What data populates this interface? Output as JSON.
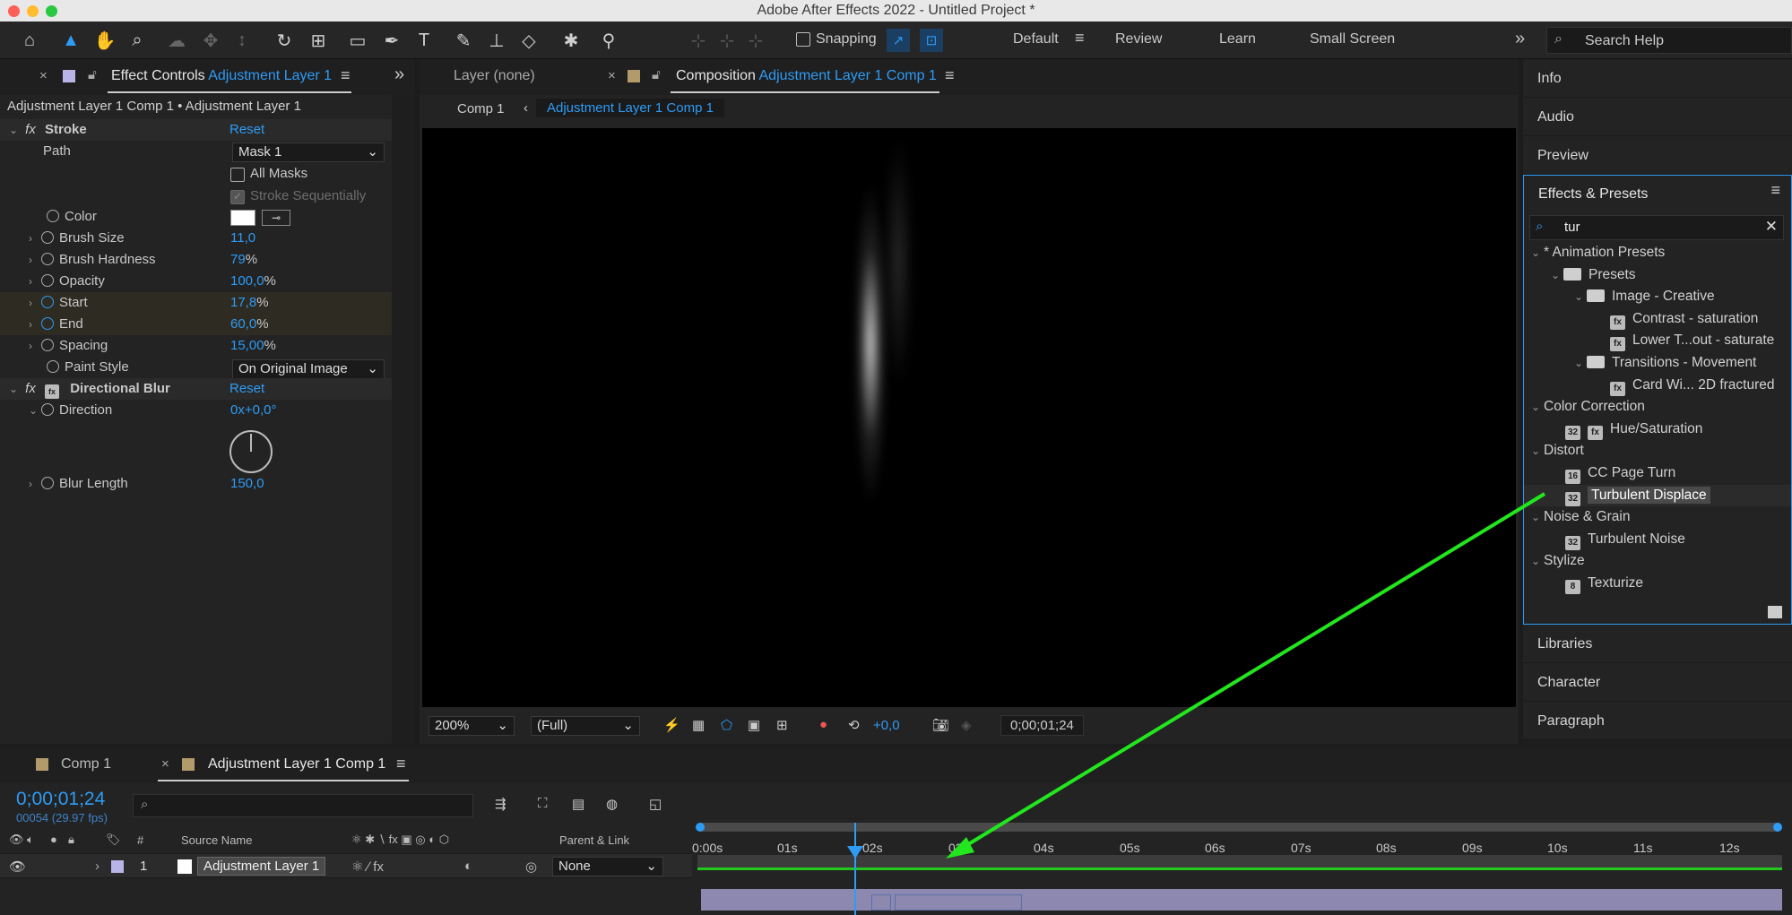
{
  "window": {
    "title": "Adobe After Effects 2022 - Untitled Project *"
  },
  "toolbar": {
    "snapping_label": "Snapping",
    "workspaces": [
      "Default",
      "Review",
      "Learn",
      "Small Screen"
    ],
    "search_help_placeholder": "Search Help",
    "more": "»"
  },
  "effect_controls": {
    "tab_label": "Effect Controls",
    "tab_layer": "Adjustment Layer 1",
    "breadcrumb": "Adjustment Layer 1 Comp 1 • Adjustment Layer 1",
    "stroke": {
      "name": "Stroke",
      "reset": "Reset",
      "path_label": "Path",
      "path_value": "Mask 1",
      "all_masks": "All Masks",
      "stroke_seq": "Stroke Sequentially",
      "color_label": "Color",
      "brush_size_label": "Brush Size",
      "brush_size": "11,0",
      "brush_hardness_label": "Brush Hardness",
      "brush_hardness": "79",
      "pct": "%",
      "opacity_label": "Opacity",
      "opacity": "100,0",
      "start_label": "Start",
      "start": "17,8",
      "end_label": "End",
      "end": "60,0",
      "spacing_label": "Spacing",
      "spacing": "15,00",
      "paint_style_label": "Paint Style",
      "paint_style": "On Original Image"
    },
    "blur": {
      "name": "Directional Blur",
      "reset": "Reset",
      "direction_label": "Direction",
      "direction": "0x+0,0°",
      "blur_length_label": "Blur Length",
      "blur_length": "150,0"
    }
  },
  "composition": {
    "layer_tab": "Layer (none)",
    "comp_tab_label": "Composition",
    "comp_tab_name": "Adjustment Layer 1 Comp 1",
    "crumb1": "Comp 1",
    "crumb2": "Adjustment Layer 1 Comp 1",
    "zoom": "200%",
    "resolution": "(Full)",
    "exposure": "+0,0",
    "timecode": "0;00;01;24"
  },
  "right_panels": {
    "top": [
      "Info",
      "Audio",
      "Preview"
    ],
    "effects_title": "Effects & Presets",
    "search_value": "tur",
    "tree": [
      "* Animation Presets",
      "Presets",
      "Image - Creative",
      "Contrast - saturation",
      "Lower T...out - saturate",
      "Transitions - Movement",
      "Card Wi... 2D fractured",
      "Color Correction",
      "Hue/Saturation",
      "Distort",
      "CC Page Turn",
      "Turbulent Displace",
      "Noise & Grain",
      "Turbulent Noise",
      "Stylize",
      "Texturize"
    ],
    "badges": {
      "b32": "32",
      "b16": "16",
      "b8": "8",
      "fx": "fx"
    },
    "bottom": [
      "Libraries",
      "Character",
      "Paragraph"
    ]
  },
  "timeline": {
    "tab1": "Comp 1",
    "tab2": "Adjustment Layer 1 Comp 1",
    "timecode": "0;00;01;24",
    "frames": "00054 (29.97 fps)",
    "col_hash": "#",
    "col_source": "Source Name",
    "col_parent": "Parent & Link",
    "layer_num": "1",
    "layer_name": "Adjustment Layer 1",
    "parent_value": "None",
    "ruler": [
      "0:00s",
      "01s",
      "02s",
      "03s",
      "04s",
      "05s",
      "06s",
      "07s",
      "08s",
      "09s",
      "10s",
      "11s",
      "12s"
    ]
  },
  "colors": {
    "accent": "#2e9bf5",
    "annotation_arrow": "#22e61e",
    "layer_bar": "#8d88b0"
  }
}
